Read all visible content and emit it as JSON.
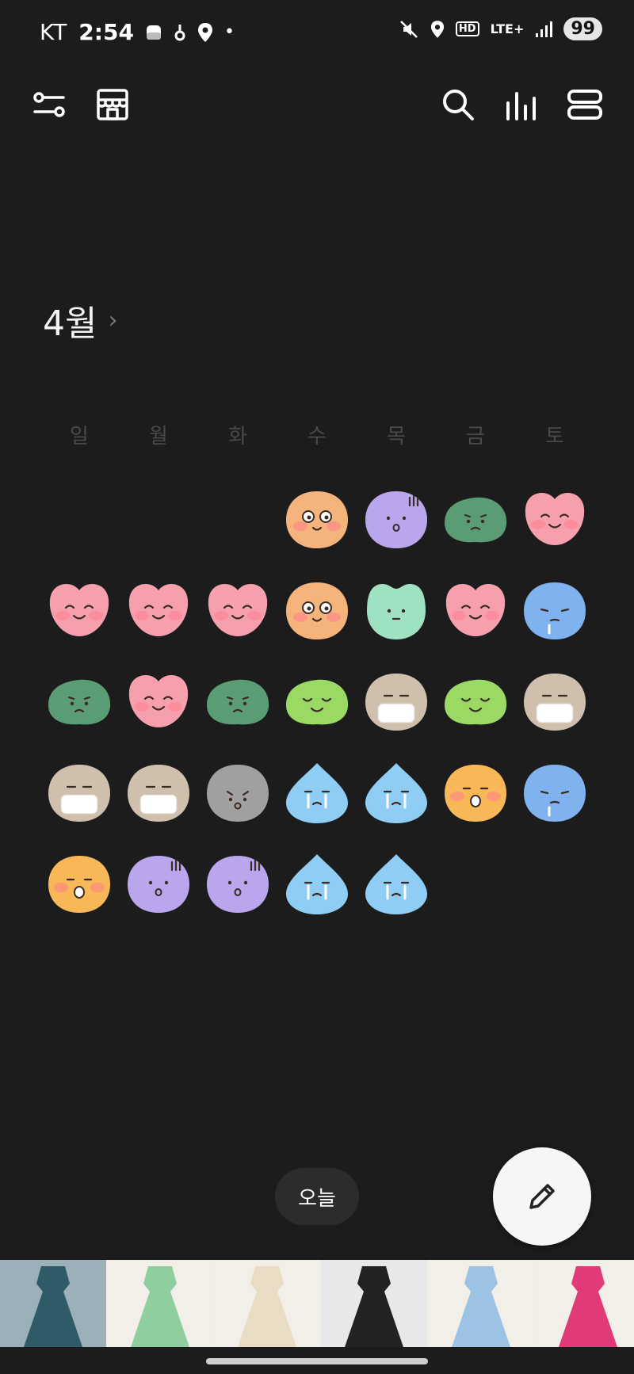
{
  "status_bar": {
    "carrier": "KT",
    "time": "2:54",
    "network": "LTE+",
    "hd_label": "HD",
    "battery": "99"
  },
  "toolbar": {
    "left_icons": [
      "filter-sliders-icon",
      "store-icon"
    ],
    "right_icons": [
      "search-icon",
      "stats-bar-icon",
      "list-view-icon"
    ]
  },
  "calendar": {
    "month_label": "4월",
    "weekdays": [
      "일",
      "월",
      "화",
      "수",
      "목",
      "금",
      "토"
    ],
    "leading_blanks": 3,
    "days": [
      {
        "mood": "starry"
      },
      {
        "mood": "shocked"
      },
      {
        "mood": "worried"
      },
      {
        "mood": "happy"
      },
      {
        "mood": "happy"
      },
      {
        "mood": "happy"
      },
      {
        "mood": "happy"
      },
      {
        "mood": "starry"
      },
      {
        "mood": "calm"
      },
      {
        "mood": "happy"
      },
      {
        "mood": "sleepy"
      },
      {
        "mood": "worried"
      },
      {
        "mood": "happy"
      },
      {
        "mood": "worried"
      },
      {
        "mood": "content"
      },
      {
        "mood": "mask"
      },
      {
        "mood": "content"
      },
      {
        "mood": "mask"
      },
      {
        "mood": "mask"
      },
      {
        "mood": "mask"
      },
      {
        "mood": "gloomy"
      },
      {
        "mood": "crying"
      },
      {
        "mood": "crying"
      },
      {
        "mood": "surprised"
      },
      {
        "mood": "sleepy"
      },
      {
        "mood": "surprised"
      },
      {
        "mood": "shocked"
      },
      {
        "mood": "shocked"
      },
      {
        "mood": "crying"
      },
      {
        "mood": "crying"
      }
    ],
    "mood_colors": {
      "happy": "#f6a0ae",
      "starry": "#f6b47d",
      "shocked": "#b9a6ec",
      "worried": "#5a9c74",
      "calm": "#9ee2c2",
      "sleepy": "#7fb2ee",
      "content": "#9ad964",
      "mask": "#cfc0ad",
      "gloomy": "#a0a0a0",
      "crying": "#8fcdf5",
      "surprised": "#f8b857"
    }
  },
  "actions": {
    "today_label": "오늘",
    "write_icon": "pencil-icon"
  },
  "ad_strip": {
    "colors": [
      "#2f5a67",
      "#8fcf9f",
      "#e9dcc4",
      "#222222",
      "#9cc3e3",
      "#e03a78"
    ]
  }
}
